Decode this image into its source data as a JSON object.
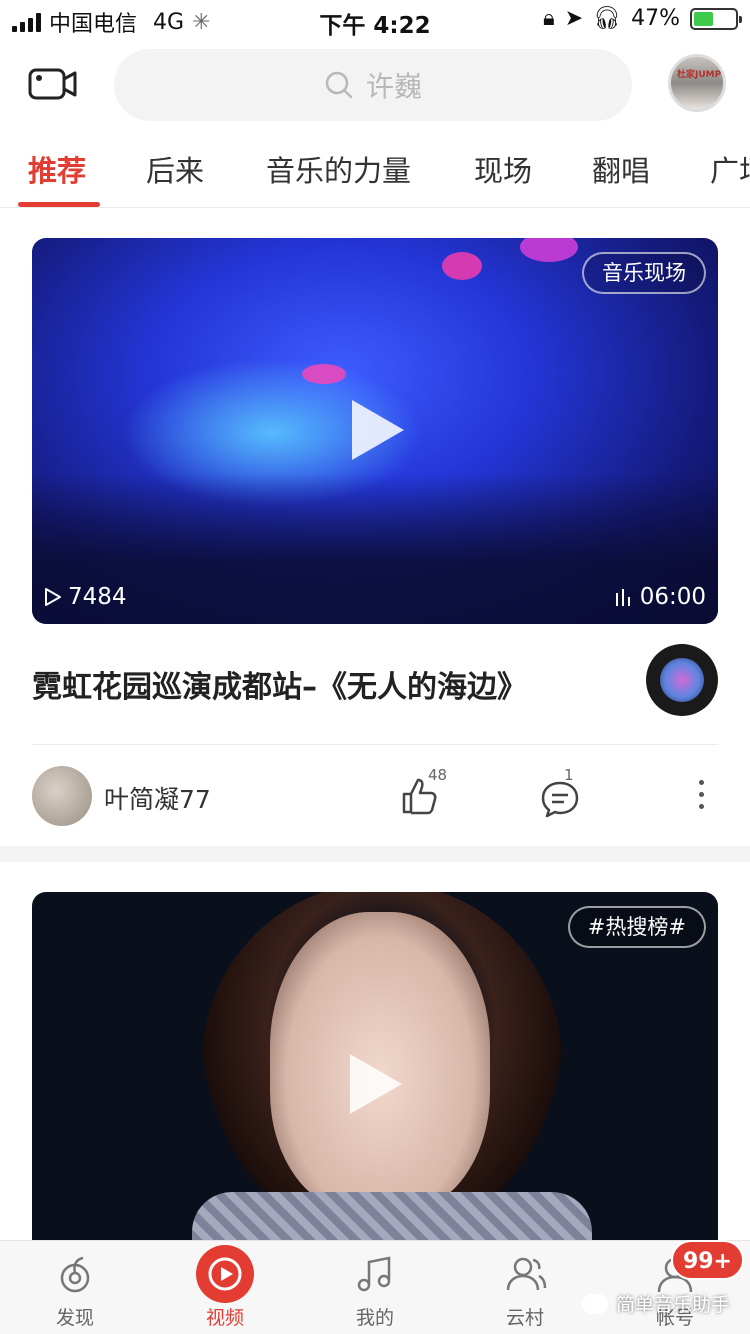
{
  "status_bar": {
    "carrier": "中国电信",
    "network": "4G",
    "time": "下午 4:22",
    "battery": "47%",
    "battery_level": 0.47
  },
  "header": {
    "search_placeholder": "许巍",
    "avatar_text": "杜家JUMP"
  },
  "tabs": [
    {
      "label": "推荐",
      "active": true
    },
    {
      "label": "后来"
    },
    {
      "label": "音乐的力量"
    },
    {
      "label": "现场"
    },
    {
      "label": "翻唱"
    },
    {
      "label": "广场"
    }
  ],
  "video1": {
    "tag": "音乐现场",
    "play_count": "7484",
    "duration": "06:00",
    "title": "霓虹花园巡演成都站–《无人的海边》",
    "author": "叶简凝77",
    "likes": "48",
    "comments": "1"
  },
  "video2": {
    "tag": "#热搜榜#"
  },
  "nav": [
    {
      "label": "发现",
      "icon": "discover-icon"
    },
    {
      "label": "视频",
      "icon": "video-icon",
      "active": true
    },
    {
      "label": "我的",
      "icon": "music-note-icon"
    },
    {
      "label": "云村",
      "icon": "friends-icon"
    },
    {
      "label": "帐号",
      "icon": "account-icon"
    }
  ],
  "badge": "99+",
  "watermark": "简单音乐助手",
  "colors": {
    "accent": "#e33d33"
  }
}
